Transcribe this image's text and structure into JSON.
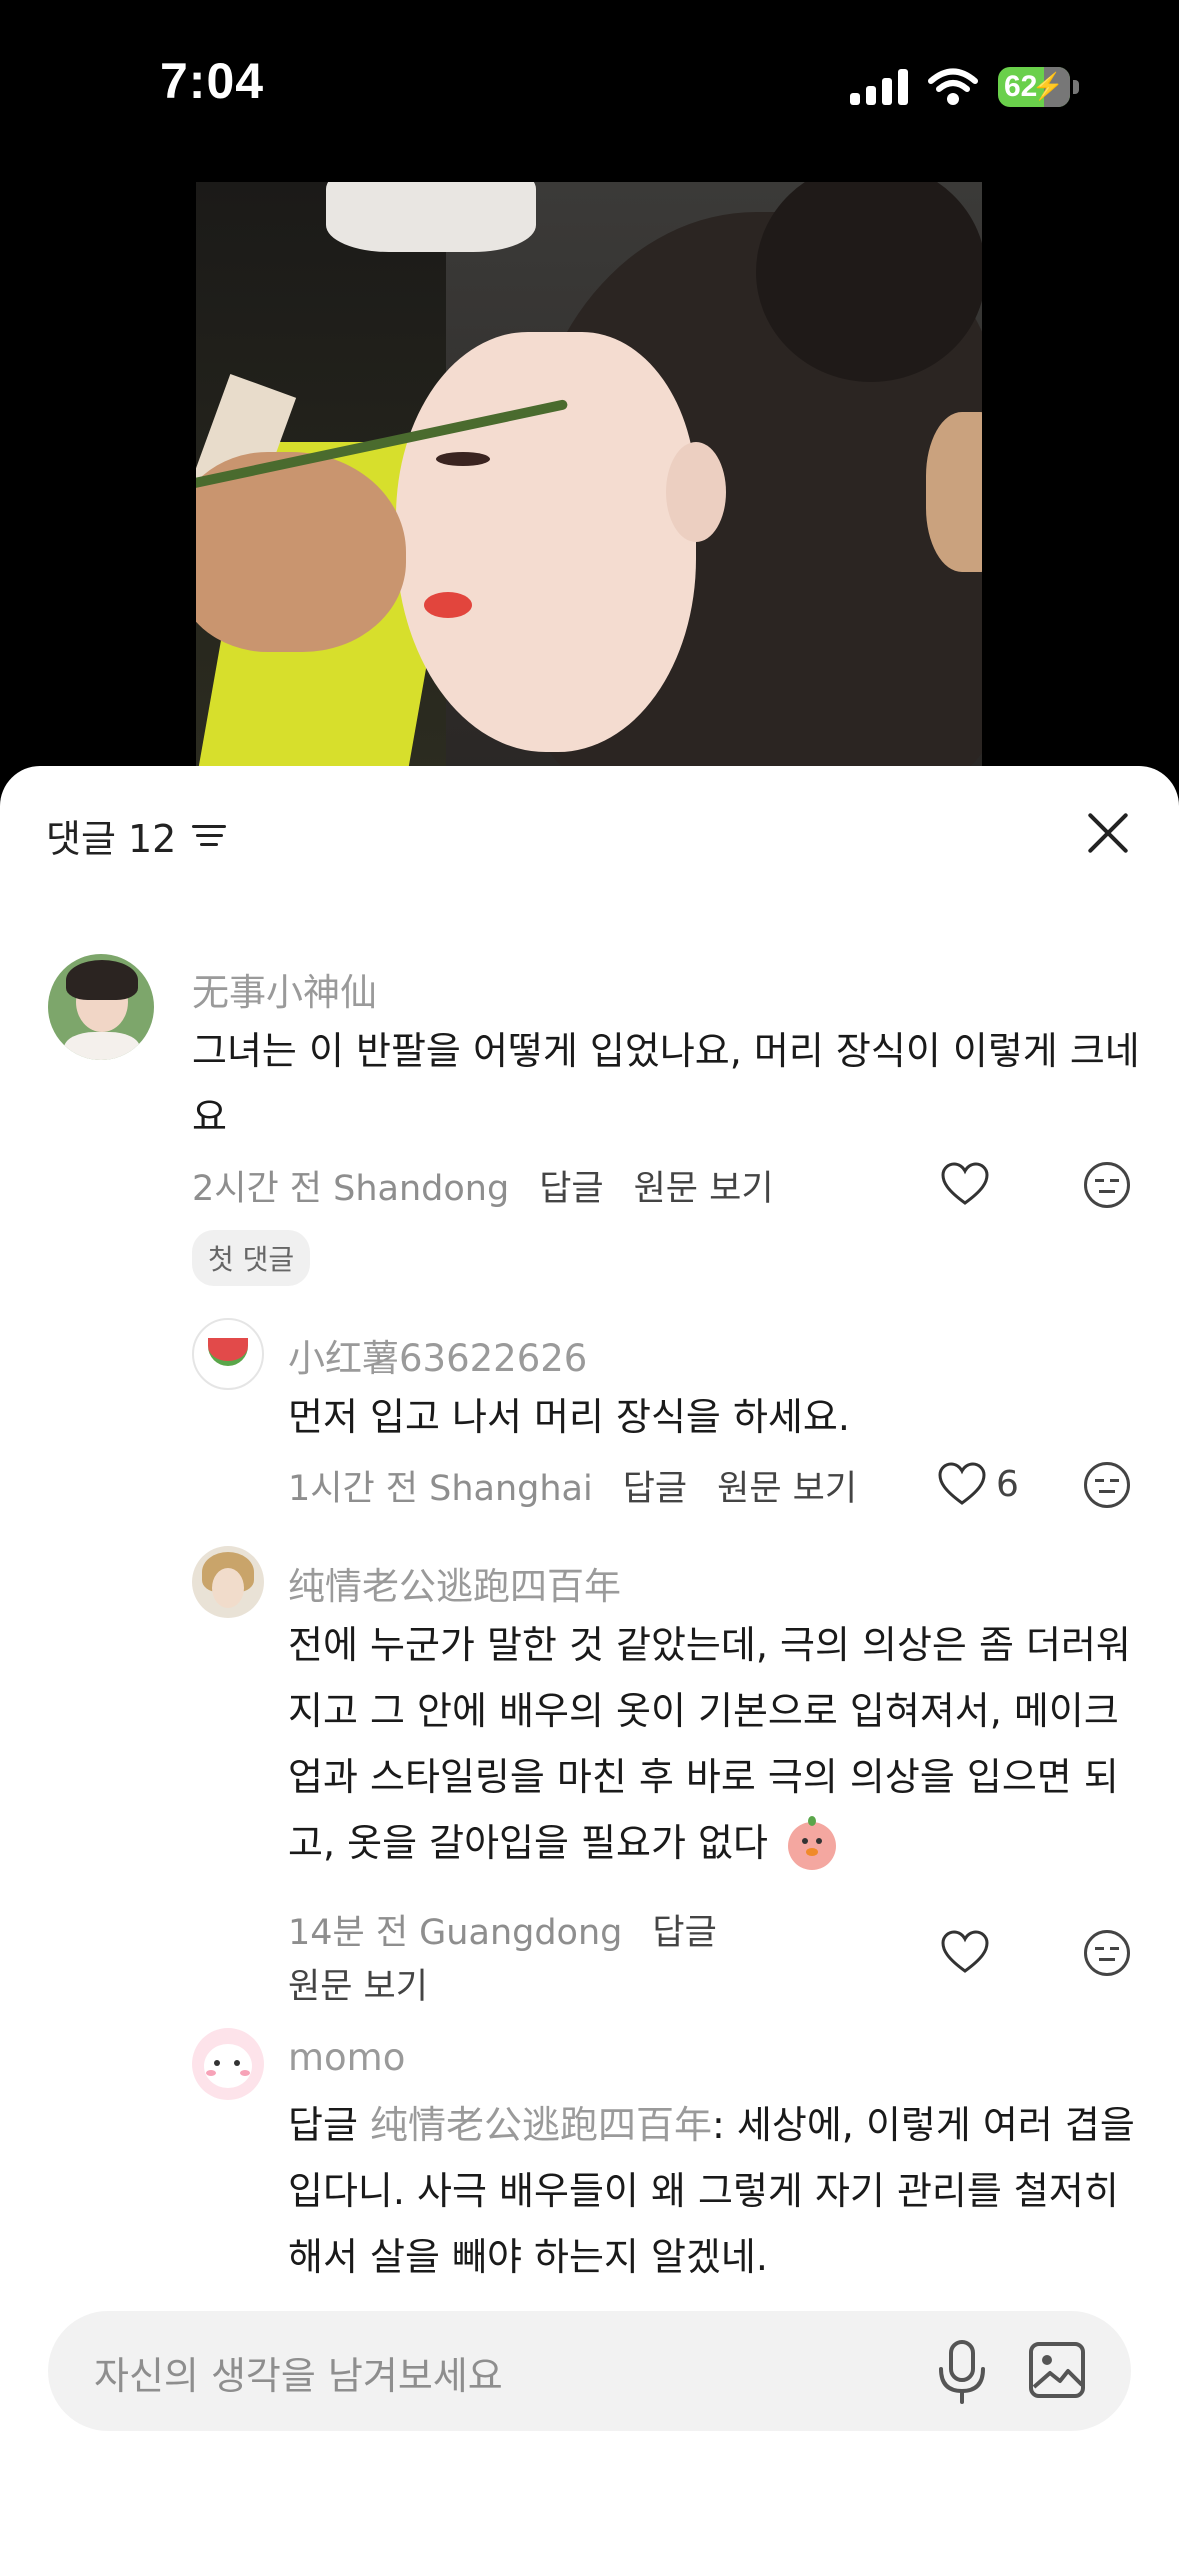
{
  "status": {
    "time": "7:04",
    "battery": "62"
  },
  "sheet": {
    "title": "댓글 12"
  },
  "comments": [
    {
      "author": "无事小神仙",
      "text": "그녀는 이 반팔을 어떻게 입었나요, 머리 장식이 이렇게 크네요",
      "time_location": "2시간 전 Shandong",
      "reply": "답글",
      "view_original": "원문 보기",
      "badge": "첫 댓글"
    },
    {
      "author": "小红薯63622626",
      "text": "먼저 입고 나서 머리 장식을 하세요.",
      "time_location": "1시간 전 Shanghai",
      "reply": "답글",
      "view_original": "원문 보기",
      "likes": "6"
    },
    {
      "author": "纯情老公逃跑四百年",
      "text": "전에 누군가 말한 것 같았는데, 극의 의상은 좀 더러워지고 그 안에 배우의 옷이 기본으로 입혀져서, 메이크업과 스타일링을 마친 후 바로 극의 의상을 입으면 되고, 옷을 갈아입을 필요가 없다",
      "time_location": "14분 전 Guangdong",
      "reply": "답글",
      "view_original": "원문 보기"
    },
    {
      "author": "momo",
      "reply_prefix": "답글",
      "mention": "纯情老公逃跑四百年",
      "text": ": 세상에, 이렇게 여러 겹을 입다니. 사극 배우들이 왜 그렇게 자기 관리를 철저히 해서 살을 빼야 하는지 알겠네."
    }
  ],
  "input": {
    "placeholder": "자신의 생각을 남겨보세요"
  },
  "colors": {
    "battery": "#6ad04b",
    "sheet_bg": "#ffffff",
    "input_bg": "#f2f2f2"
  }
}
